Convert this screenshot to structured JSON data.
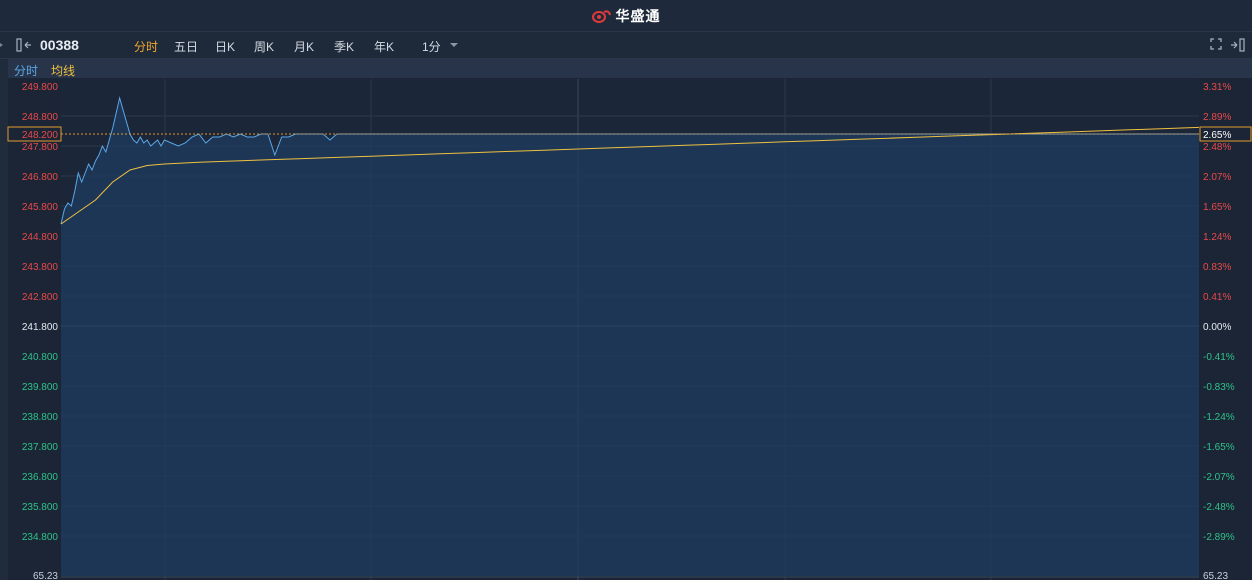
{
  "brand": {
    "name": "华盛通"
  },
  "toolbar": {
    "symbol": "00388",
    "tabs": [
      {
        "label": "分时",
        "active": true
      },
      {
        "label": "五日",
        "active": false
      },
      {
        "label": "日K",
        "active": false
      },
      {
        "label": "周K",
        "active": false
      },
      {
        "label": "月K",
        "active": false
      },
      {
        "label": "季K",
        "active": false
      },
      {
        "label": "年K",
        "active": false
      }
    ],
    "interval": "1分"
  },
  "legend": {
    "line1": "分时",
    "line2": "均线"
  },
  "colors": {
    "up": "#e84a4a",
    "down": "#2fc28a",
    "price_line": "#5aa7e8",
    "avg_line": "#f0c040",
    "active_tab": "#f0a830"
  },
  "chart_data": {
    "type": "line",
    "base_price": 241.8,
    "ylim": [
      234.25,
      249.8
    ],
    "left_ticks": [
      "249.800",
      "248.800",
      "247.800",
      "246.800",
      "245.800",
      "244.800",
      "243.800",
      "242.800",
      "241.800",
      "240.800",
      "239.800",
      "238.800",
      "237.800",
      "236.800",
      "235.800",
      "234.800"
    ],
    "right_ticks": [
      "3.31%",
      "2.89%",
      "2.48%",
      "2.07%",
      "1.65%",
      "1.24%",
      "0.83%",
      "0.41%",
      "0.00%",
      "-0.41%",
      "-0.83%",
      "-1.24%",
      "-1.65%",
      "-2.07%",
      "-2.48%",
      "-2.89%"
    ],
    "current_price": {
      "value": 248.2,
      "label": "248.200",
      "pct": "2.65%"
    },
    "volume_max_label": "65.23",
    "x_minutes_total": 330,
    "series": [
      {
        "kind": "price",
        "x": [
          0,
          1,
          2,
          3,
          4,
          5,
          6,
          7,
          8,
          9,
          10,
          11,
          12,
          13,
          14,
          15,
          16,
          17,
          18,
          19,
          20,
          21,
          22,
          23,
          24,
          25,
          26,
          27,
          28,
          29,
          30,
          32,
          34,
          36,
          38,
          40,
          42,
          44,
          46,
          48,
          50,
          52,
          54,
          56,
          58,
          60,
          62,
          64,
          66,
          68,
          70,
          72,
          74,
          76,
          78,
          80,
          82,
          84,
          86,
          88,
          90,
          92,
          94,
          96,
          98,
          100,
          102,
          104,
          106,
          108,
          110,
          112,
          114,
          116,
          118,
          120,
          122,
          124,
          126,
          128,
          130,
          132,
          134,
          136,
          138,
          140,
          142,
          144,
          146,
          148,
          150,
          152,
          154,
          156,
          158,
          160,
          162,
          164,
          166,
          168,
          170,
          172,
          174,
          176,
          178,
          180,
          182,
          184,
          186,
          188,
          190,
          192,
          194,
          196,
          198,
          200,
          202,
          204,
          206,
          208,
          210,
          212,
          214,
          216,
          218,
          220,
          222,
          224,
          226,
          228,
          230,
          232,
          234,
          236,
          238,
          240,
          242,
          244,
          246,
          248,
          250,
          252,
          254,
          256,
          258,
          260,
          262,
          264,
          266,
          268,
          270,
          272,
          274,
          276,
          278,
          280,
          282,
          284,
          286,
          288,
          290,
          292,
          294,
          296,
          298,
          300,
          302,
          304,
          306,
          308,
          310,
          312,
          314,
          316,
          318,
          320,
          322,
          324,
          326,
          328,
          330
        ],
        "values": [
          245.2,
          245.7,
          245.9,
          245.8,
          246.3,
          246.9,
          246.6,
          246.9,
          247.2,
          247.0,
          247.3,
          247.5,
          247.8,
          247.6,
          248.0,
          248.4,
          248.9,
          249.4,
          249.0,
          248.6,
          248.2,
          248.0,
          247.9,
          248.1,
          247.9,
          248.0,
          247.8,
          247.9,
          248.0,
          247.8,
          248.0,
          247.9,
          247.8,
          247.9,
          248.1,
          248.2,
          247.9,
          248.1,
          248.1,
          248.2,
          248.1,
          248.2,
          248.1,
          248.1,
          248.2,
          248.2,
          247.5,
          248.1,
          248.1,
          248.2,
          248.2,
          248.2,
          248.2,
          248.2,
          248.0,
          248.2,
          248.2,
          248.2,
          248.2,
          248.2,
          248.2,
          248.2,
          248.2,
          248.2,
          248.2,
          248.2,
          248.2,
          248.2,
          248.2,
          248.2,
          248.2,
          248.2,
          248.2,
          248.2,
          248.2,
          248.2,
          248.2,
          248.2,
          248.2,
          248.2,
          248.2,
          248.2,
          248.2,
          248.2,
          248.2,
          248.2,
          248.2,
          248.2,
          248.2,
          248.2,
          248.2,
          248.2,
          248.2,
          248.2,
          248.2,
          248.2,
          248.2,
          248.2,
          248.2,
          248.2,
          248.2,
          248.2,
          248.2,
          248.2,
          248.2,
          248.2,
          248.2,
          248.2,
          248.2,
          248.2,
          248.2,
          248.2,
          248.2,
          248.2,
          248.2,
          248.2,
          248.2,
          248.2,
          248.2,
          248.2,
          248.2,
          248.2,
          248.2,
          248.2,
          248.2,
          248.2,
          248.2,
          248.2,
          248.2,
          248.2,
          248.2,
          248.2,
          248.2,
          248.2,
          248.2,
          248.2,
          248.2,
          248.2,
          248.2,
          248.2,
          248.2,
          248.2,
          248.2,
          248.2,
          248.2,
          248.2,
          248.2,
          248.2,
          248.2,
          248.2,
          248.2,
          248.2,
          248.2,
          248.2,
          248.2,
          248.2,
          248.2,
          248.2,
          248.2,
          248.2,
          248.2,
          248.2,
          248.2,
          248.2,
          248.2,
          248.2,
          248.2,
          248.2,
          248.2,
          248.2,
          248.2,
          248.2,
          248.2,
          248.2,
          248.2,
          248.2,
          248.2,
          248.2,
          248.2,
          248.2,
          248.2
        ]
      },
      {
        "kind": "average",
        "x": [
          0,
          5,
          10,
          15,
          20,
          25,
          30,
          40,
          50,
          60,
          70,
          80,
          90,
          100,
          110,
          120,
          130,
          140,
          150,
          160,
          170,
          180,
          190,
          200,
          210,
          220,
          230,
          240,
          250,
          260,
          270,
          280,
          290,
          300,
          310,
          320,
          330
        ],
        "values": [
          245.2,
          245.6,
          246.0,
          246.6,
          247.0,
          247.15,
          247.2,
          247.26,
          247.3,
          247.34,
          247.38,
          247.42,
          247.46,
          247.5,
          247.54,
          247.58,
          247.62,
          247.66,
          247.7,
          247.74,
          247.78,
          247.82,
          247.86,
          247.9,
          247.94,
          247.98,
          248.02,
          248.06,
          248.1,
          248.14,
          248.18,
          248.22,
          248.26,
          248.3,
          248.34,
          248.38,
          248.42
        ]
      }
    ]
  }
}
